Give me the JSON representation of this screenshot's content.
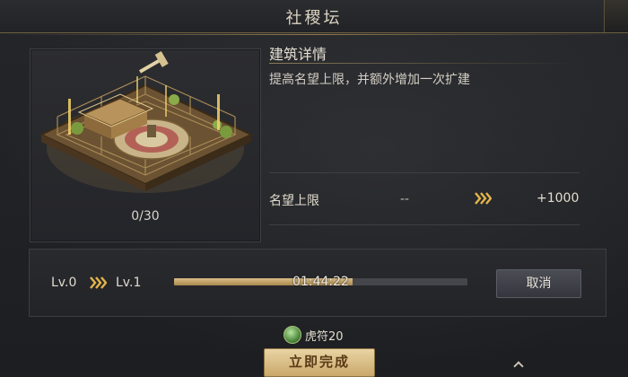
{
  "window": {
    "title": "社稷坛"
  },
  "building": {
    "image_label": "altar-building",
    "progress_count": "0/30"
  },
  "detail": {
    "heading": "建筑详情",
    "description": "提高名望上限，并额外增加一次扩建",
    "stat": {
      "label": "名望上限",
      "from": "--",
      "to": "+1000"
    }
  },
  "upgrade": {
    "from_level": "Lv.0",
    "to_level": "Lv.1",
    "progress_fraction": 0.61,
    "time_remaining": "01:44:22",
    "cancel_label": "取消"
  },
  "cost": {
    "icon": "tiger-tally-icon",
    "text": "虎符20"
  },
  "complete_label": "立即完成",
  "colors": {
    "accent_gold": "#d9bd86",
    "button_gold": "#e9d4a4",
    "arrow_gold": "#e3b54a"
  }
}
